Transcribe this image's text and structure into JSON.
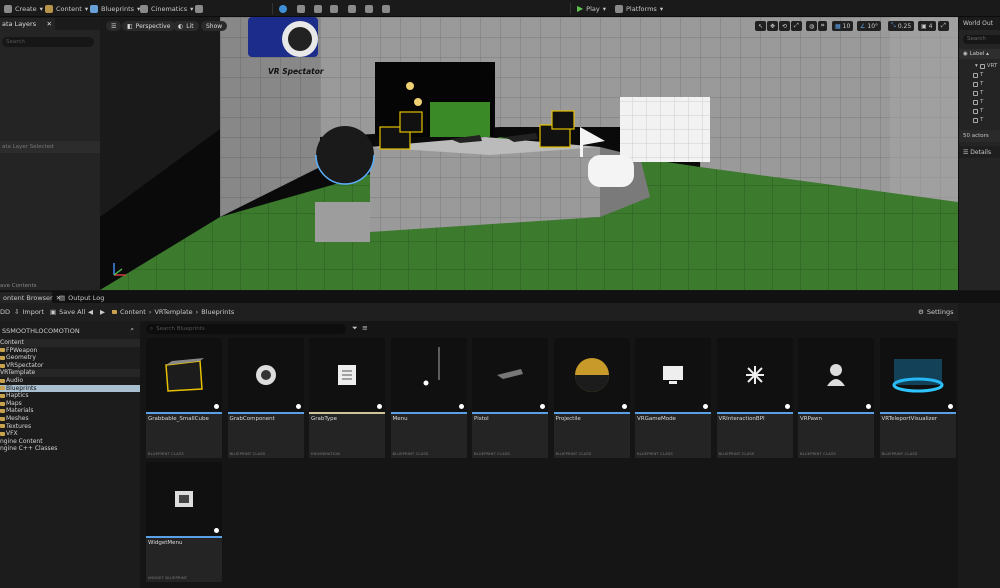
{
  "toolbar": {
    "create": "Create",
    "content": "Content",
    "blueprints": "Blueprints",
    "cinematics": "Cinematics",
    "play": "Play",
    "platforms": "Platforms"
  },
  "data_layers": {
    "tab": "ata Layers",
    "search_placeholder": "Search",
    "status": "ata Layer Selected",
    "footer": "ave Contents"
  },
  "viewport": {
    "perspective": "Perspective",
    "lit": "Lit",
    "show": "Show",
    "actor_label": "VR Spectator",
    "grid_snap": "10",
    "rot_snap": "10°",
    "scale_snap": "0.25",
    "cam_speed": "4"
  },
  "outliner": {
    "tab": "World Out",
    "search_placeholder": "Search",
    "column": "Label",
    "root": "VRT",
    "rows": [
      "T",
      "T",
      "T",
      "T",
      "T",
      "T"
    ],
    "actor_count": "50 actors",
    "details_tab": "Details"
  },
  "bottom_tabs": {
    "content_browser": "ontent Browser",
    "output_log": "Output Log"
  },
  "cb_toolbar": {
    "add": "DD",
    "import": "Import",
    "save_all": "Save All",
    "crumbs": [
      "Content",
      "VRTemplate",
      "Blueprints"
    ],
    "settings": "Settings"
  },
  "sources": {
    "project": "SSMOOTHLOCOMOTION",
    "tree": [
      {
        "label": "Content",
        "kind": "section"
      },
      {
        "label": "FPWeapon",
        "kind": "folder"
      },
      {
        "label": "Geometry",
        "kind": "folder"
      },
      {
        "label": "VRSpectator",
        "kind": "folder"
      },
      {
        "label": "VRTemplate",
        "kind": "section"
      },
      {
        "label": "Audio",
        "kind": "folder"
      },
      {
        "label": "Blueprints",
        "kind": "selected"
      },
      {
        "label": "Haptics",
        "kind": "folder"
      },
      {
        "label": "Maps",
        "kind": "folder"
      },
      {
        "label": "Materials",
        "kind": "folder"
      },
      {
        "label": "Meshes",
        "kind": "folder"
      },
      {
        "label": "Textures",
        "kind": "folder"
      },
      {
        "label": "VFX",
        "kind": "folder"
      },
      {
        "label": "ngine Content",
        "kind": "plain"
      },
      {
        "label": "ngine C++ Classes",
        "kind": "plain"
      }
    ]
  },
  "assets": {
    "search_placeholder": "Search Blueprints",
    "items": [
      {
        "name": "Grabbable_SmallCube",
        "type": "BLUEPRINT CLASS",
        "color": "#5aa0e6",
        "icon": "cube-icon"
      },
      {
        "name": "GrabComponent",
        "type": "BLUEPRINT CLASS",
        "color": "#5aa0e6",
        "icon": "component-icon"
      },
      {
        "name": "GrabType",
        "type": "ENUMERATION",
        "color": "#cfc39a",
        "icon": "enum-icon"
      },
      {
        "name": "Menu",
        "type": "BLUEPRINT CLASS",
        "color": "#5aa0e6",
        "icon": "menu-icon"
      },
      {
        "name": "Pistol",
        "type": "BLUEPRINT CLASS",
        "color": "#5aa0e6",
        "icon": "pistol-icon"
      },
      {
        "name": "Projectile",
        "type": "BLUEPRINT CLASS",
        "color": "#5aa0e6",
        "icon": "projectile-icon"
      },
      {
        "name": "VRGameMode",
        "type": "BLUEPRINT CLASS",
        "color": "#5aa0e6",
        "icon": "gamemode-icon"
      },
      {
        "name": "VRInteractionBPI",
        "type": "BLUEPRINT CLASS",
        "color": "#5aa0e6",
        "icon": "interface-icon"
      },
      {
        "name": "VRPawn",
        "type": "BLUEPRINT CLASS",
        "color": "#5aa0e6",
        "icon": "pawn-icon"
      },
      {
        "name": "VRTeleportVisualizer",
        "type": "BLUEPRINT CLASS",
        "color": "#5aa0e6",
        "icon": "teleport-icon"
      },
      {
        "name": "WidgetMenu",
        "type": "WIDGET BLUEPRINT",
        "color": "#5aa0e6",
        "icon": "widget-icon"
      }
    ]
  }
}
